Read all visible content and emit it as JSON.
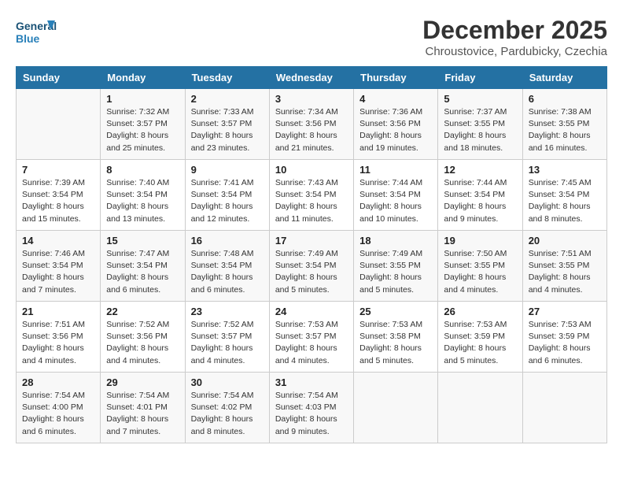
{
  "header": {
    "logo_line1": "General",
    "logo_line2": "Blue",
    "month": "December 2025",
    "location": "Chroustovice, Pardubicky, Czechia"
  },
  "days_of_week": [
    "Sunday",
    "Monday",
    "Tuesday",
    "Wednesday",
    "Thursday",
    "Friday",
    "Saturday"
  ],
  "weeks": [
    [
      {
        "day": "",
        "info": ""
      },
      {
        "day": "1",
        "info": "Sunrise: 7:32 AM\nSunset: 3:57 PM\nDaylight: 8 hours\nand 25 minutes."
      },
      {
        "day": "2",
        "info": "Sunrise: 7:33 AM\nSunset: 3:57 PM\nDaylight: 8 hours\nand 23 minutes."
      },
      {
        "day": "3",
        "info": "Sunrise: 7:34 AM\nSunset: 3:56 PM\nDaylight: 8 hours\nand 21 minutes."
      },
      {
        "day": "4",
        "info": "Sunrise: 7:36 AM\nSunset: 3:56 PM\nDaylight: 8 hours\nand 19 minutes."
      },
      {
        "day": "5",
        "info": "Sunrise: 7:37 AM\nSunset: 3:55 PM\nDaylight: 8 hours\nand 18 minutes."
      },
      {
        "day": "6",
        "info": "Sunrise: 7:38 AM\nSunset: 3:55 PM\nDaylight: 8 hours\nand 16 minutes."
      }
    ],
    [
      {
        "day": "7",
        "info": "Sunrise: 7:39 AM\nSunset: 3:54 PM\nDaylight: 8 hours\nand 15 minutes."
      },
      {
        "day": "8",
        "info": "Sunrise: 7:40 AM\nSunset: 3:54 PM\nDaylight: 8 hours\nand 13 minutes."
      },
      {
        "day": "9",
        "info": "Sunrise: 7:41 AM\nSunset: 3:54 PM\nDaylight: 8 hours\nand 12 minutes."
      },
      {
        "day": "10",
        "info": "Sunrise: 7:43 AM\nSunset: 3:54 PM\nDaylight: 8 hours\nand 11 minutes."
      },
      {
        "day": "11",
        "info": "Sunrise: 7:44 AM\nSunset: 3:54 PM\nDaylight: 8 hours\nand 10 minutes."
      },
      {
        "day": "12",
        "info": "Sunrise: 7:44 AM\nSunset: 3:54 PM\nDaylight: 8 hours\nand 9 minutes."
      },
      {
        "day": "13",
        "info": "Sunrise: 7:45 AM\nSunset: 3:54 PM\nDaylight: 8 hours\nand 8 minutes."
      }
    ],
    [
      {
        "day": "14",
        "info": "Sunrise: 7:46 AM\nSunset: 3:54 PM\nDaylight: 8 hours\nand 7 minutes."
      },
      {
        "day": "15",
        "info": "Sunrise: 7:47 AM\nSunset: 3:54 PM\nDaylight: 8 hours\nand 6 minutes."
      },
      {
        "day": "16",
        "info": "Sunrise: 7:48 AM\nSunset: 3:54 PM\nDaylight: 8 hours\nand 6 minutes."
      },
      {
        "day": "17",
        "info": "Sunrise: 7:49 AM\nSunset: 3:54 PM\nDaylight: 8 hours\nand 5 minutes."
      },
      {
        "day": "18",
        "info": "Sunrise: 7:49 AM\nSunset: 3:55 PM\nDaylight: 8 hours\nand 5 minutes."
      },
      {
        "day": "19",
        "info": "Sunrise: 7:50 AM\nSunset: 3:55 PM\nDaylight: 8 hours\nand 4 minutes."
      },
      {
        "day": "20",
        "info": "Sunrise: 7:51 AM\nSunset: 3:55 PM\nDaylight: 8 hours\nand 4 minutes."
      }
    ],
    [
      {
        "day": "21",
        "info": "Sunrise: 7:51 AM\nSunset: 3:56 PM\nDaylight: 8 hours\nand 4 minutes."
      },
      {
        "day": "22",
        "info": "Sunrise: 7:52 AM\nSunset: 3:56 PM\nDaylight: 8 hours\nand 4 minutes."
      },
      {
        "day": "23",
        "info": "Sunrise: 7:52 AM\nSunset: 3:57 PM\nDaylight: 8 hours\nand 4 minutes."
      },
      {
        "day": "24",
        "info": "Sunrise: 7:53 AM\nSunset: 3:57 PM\nDaylight: 8 hours\nand 4 minutes."
      },
      {
        "day": "25",
        "info": "Sunrise: 7:53 AM\nSunset: 3:58 PM\nDaylight: 8 hours\nand 5 minutes."
      },
      {
        "day": "26",
        "info": "Sunrise: 7:53 AM\nSunset: 3:59 PM\nDaylight: 8 hours\nand 5 minutes."
      },
      {
        "day": "27",
        "info": "Sunrise: 7:53 AM\nSunset: 3:59 PM\nDaylight: 8 hours\nand 6 minutes."
      }
    ],
    [
      {
        "day": "28",
        "info": "Sunrise: 7:54 AM\nSunset: 4:00 PM\nDaylight: 8 hours\nand 6 minutes."
      },
      {
        "day": "29",
        "info": "Sunrise: 7:54 AM\nSunset: 4:01 PM\nDaylight: 8 hours\nand 7 minutes."
      },
      {
        "day": "30",
        "info": "Sunrise: 7:54 AM\nSunset: 4:02 PM\nDaylight: 8 hours\nand 8 minutes."
      },
      {
        "day": "31",
        "info": "Sunrise: 7:54 AM\nSunset: 4:03 PM\nDaylight: 8 hours\nand 9 minutes."
      },
      {
        "day": "",
        "info": ""
      },
      {
        "day": "",
        "info": ""
      },
      {
        "day": "",
        "info": ""
      }
    ]
  ]
}
